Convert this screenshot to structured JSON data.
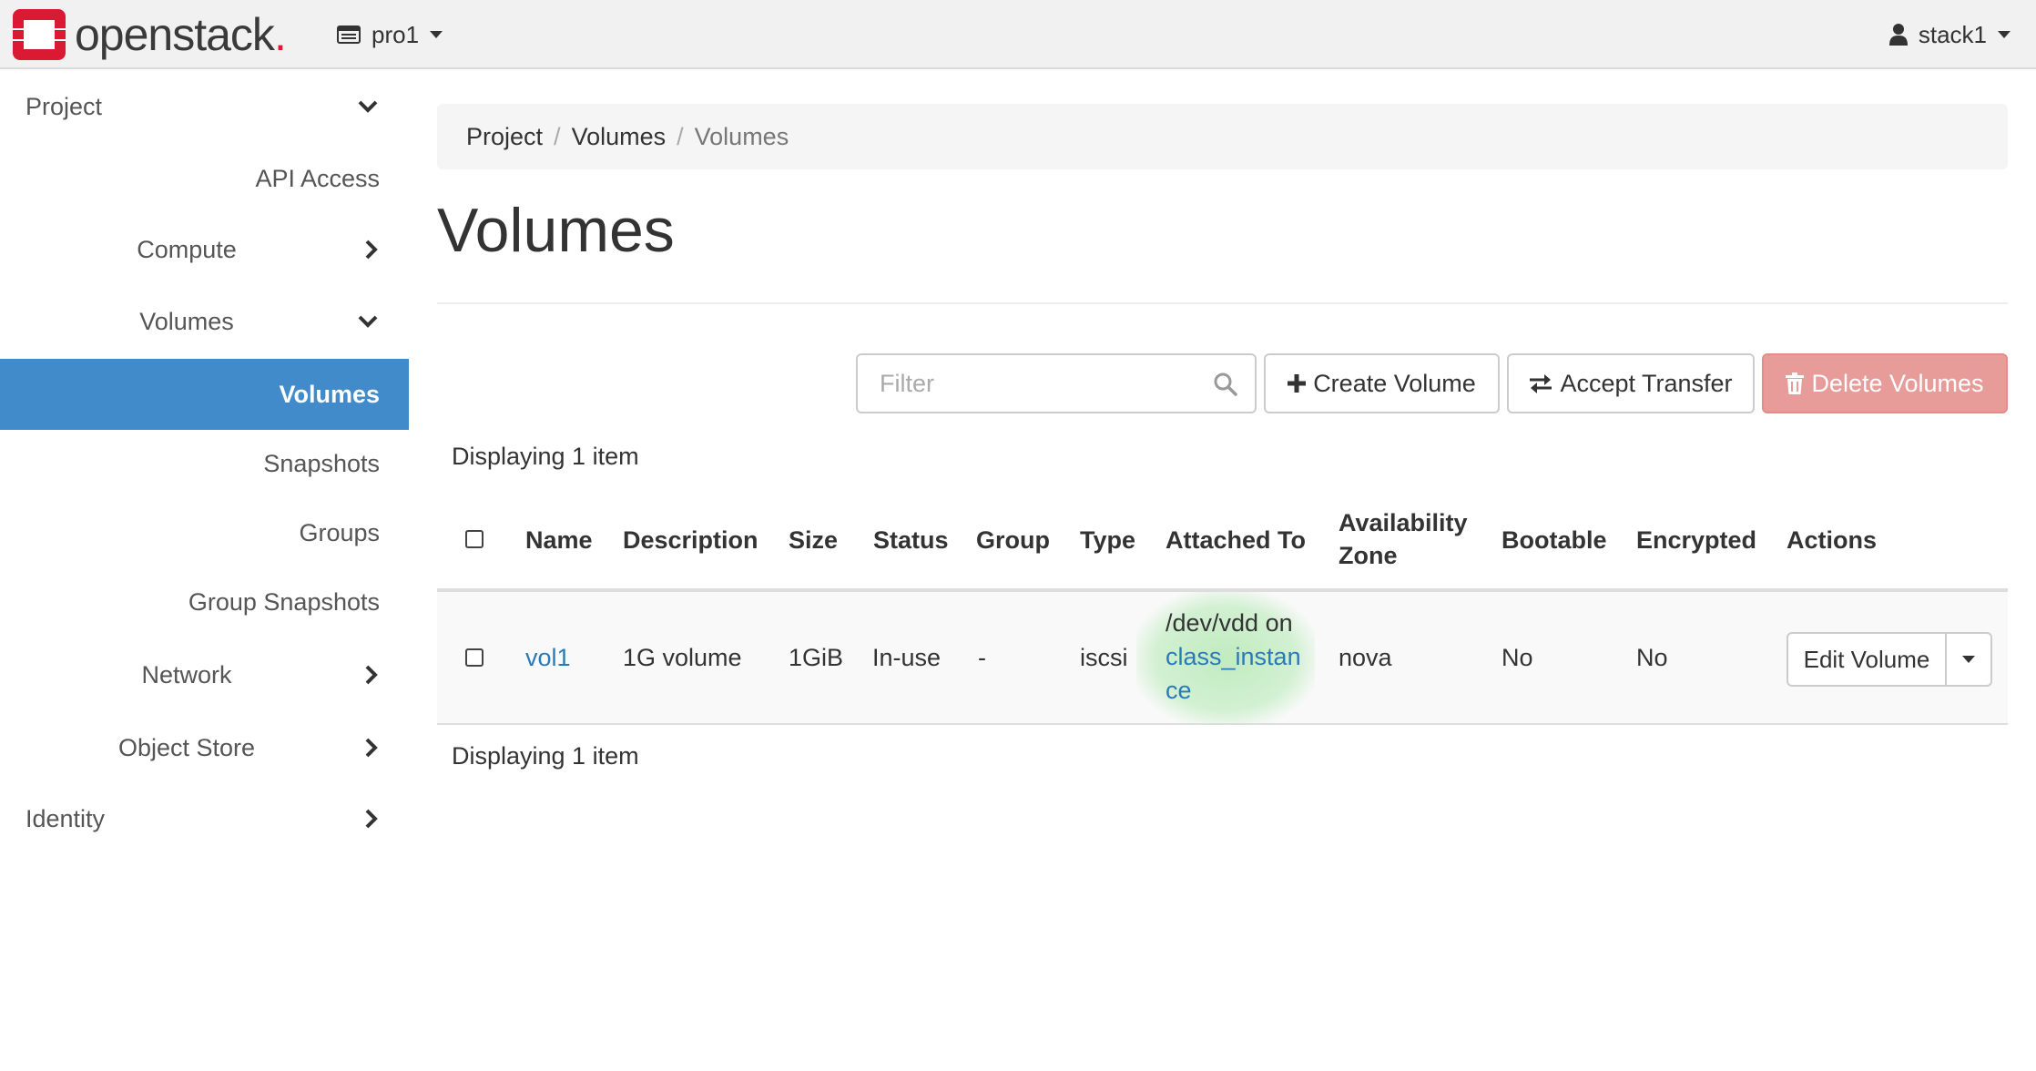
{
  "brand": {
    "name": "openstack",
    "dot": "."
  },
  "header": {
    "project": "pro1",
    "user": "stack1"
  },
  "sidebar": {
    "project": "Project",
    "api_access": "API Access",
    "compute": "Compute",
    "volumes_group": "Volumes",
    "volumes": "Volumes",
    "snapshots": "Snapshots",
    "groups": "Groups",
    "group_snapshots": "Group Snapshots",
    "network": "Network",
    "object_store": "Object Store",
    "identity": "Identity"
  },
  "breadcrumb": [
    "Project",
    "Volumes",
    "Volumes"
  ],
  "page_title": "Volumes",
  "toolbar": {
    "filter_placeholder": "Filter",
    "create_label": "Create Volume",
    "accept_label": "Accept Transfer",
    "delete_label": "Delete Volumes"
  },
  "display_count": "Displaying 1 item",
  "table": {
    "headers": {
      "name": "Name",
      "description": "Description",
      "size": "Size",
      "status": "Status",
      "group": "Group",
      "type": "Type",
      "attached": "Attached To",
      "az_line1": "Availability",
      "az_line2": "Zone",
      "bootable": "Bootable",
      "encrypted": "Encrypted",
      "actions": "Actions"
    },
    "rows": [
      {
        "name": "vol1",
        "description": "1G volume",
        "size": "1GiB",
        "status": "In-use",
        "group": "-",
        "type": "iscsi",
        "attached_prefix": "/dev/vdd on",
        "attached_link_line1": "class_instan",
        "attached_link_line2": "ce",
        "az": "nova",
        "bootable": "No",
        "encrypted": "No",
        "action": "Edit Volume"
      }
    ]
  },
  "colors": {
    "active": "#428bca",
    "danger": "#e89c99",
    "link": "#2a7ab8",
    "brand_red": "#da1a32",
    "highlight": "#c8eec8"
  }
}
